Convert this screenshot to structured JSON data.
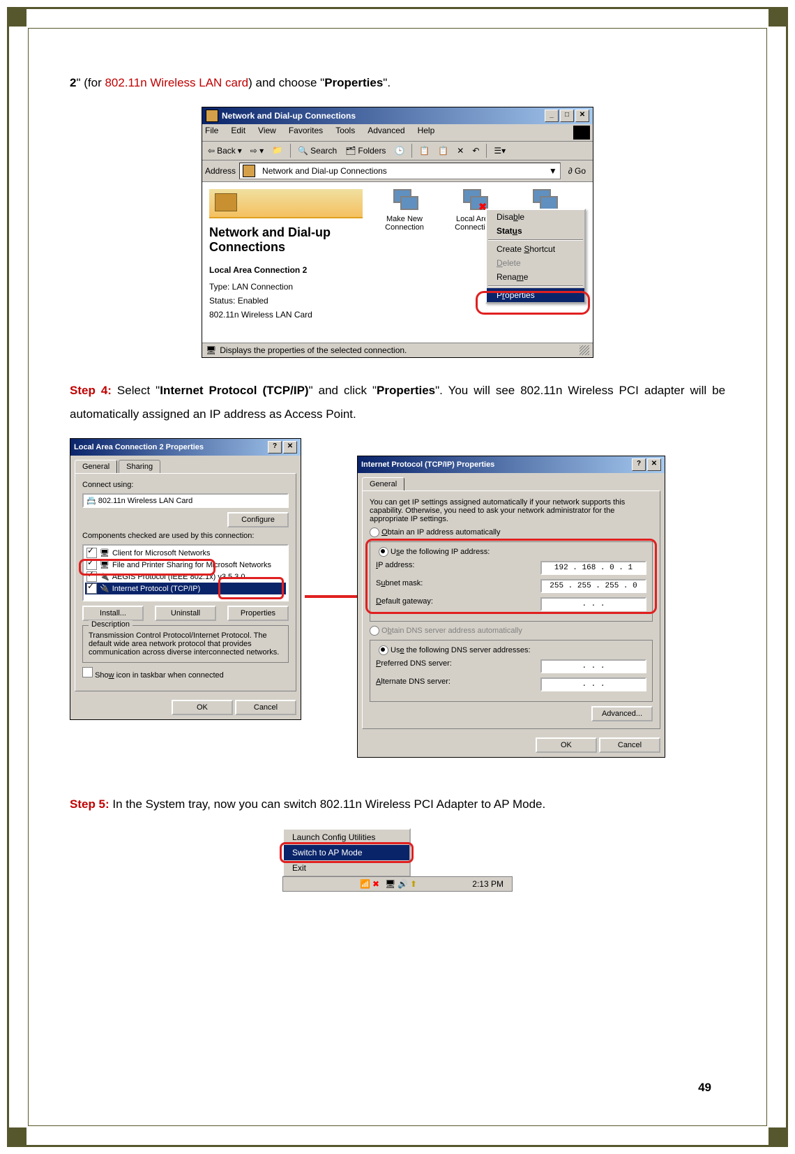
{
  "intro": {
    "prefix": "2",
    "mid1": "\" (for ",
    "link": "802.11n Wireless LAN card",
    "mid2": ") and choose \"",
    "bold": "Properties",
    "mid3": "\"."
  },
  "win1": {
    "title": "Network and Dial-up Connections",
    "menu": [
      "File",
      "Edit",
      "View",
      "Favorites",
      "Tools",
      "Advanced",
      "Help"
    ],
    "toolbar": {
      "back": "Back",
      "search": "Search",
      "folders": "Folders"
    },
    "addr_label": "Address",
    "addr_value": "Network and Dial-up Connections",
    "go": "Go",
    "panel_title": "Network and Dial-up Connections",
    "sel_title": "Local Area Connection 2",
    "type_line": "Type: LAN Connection",
    "status_line": "Status: Enabled",
    "card_line": "802.11n Wireless LAN Card",
    "items": {
      "makenew": "Make New Connection",
      "lac": "Local Area Connection",
      "lac2": "Local Area Connection 2"
    },
    "ctx": {
      "disable": "Disable",
      "status": "Status",
      "shortcut": "Create Shortcut",
      "delete": "Delete",
      "rename": "Rename",
      "properties": "Properties"
    },
    "statusbar": "Displays the properties of the selected connection."
  },
  "step4": {
    "label": "Step 4:",
    "t1": " Select \"",
    "b1": "Internet Protocol (TCP/IP)",
    "t2": "\" and click \"",
    "b2": "Properties",
    "t3": "\". You will see 802.11n Wireless PCI adapter will be automatically assigned an IP address as Access Point."
  },
  "dlg1": {
    "title": "Local Area Connection 2 Properties",
    "tab_general": "General",
    "tab_sharing": "Sharing",
    "connect_using": "Connect using:",
    "adapter": "802.11n Wireless LAN Card",
    "configure": "Configure",
    "components": "Components checked are used by this connection:",
    "list": [
      "Client for Microsoft Networks",
      "File and Printer Sharing for Microsoft Networks",
      "AEGIS Protocol (IEEE 802.1x) v3.5.3.0",
      "Internet Protocol (TCP/IP)"
    ],
    "install": "Install...",
    "uninstall": "Uninstall",
    "properties": "Properties",
    "desc_label": "Description",
    "desc_text": "Transmission Control Protocol/Internet Protocol. The default wide area network protocol that provides communication across diverse interconnected networks.",
    "show_icon": "Show icon in taskbar when connected",
    "ok": "OK",
    "cancel": "Cancel"
  },
  "dlg2": {
    "title": "Internet Protocol (TCP/IP) Properties",
    "tab_general": "General",
    "blurb": "You can get IP settings assigned automatically if your network supports this capability. Otherwise, you need to ask your network administrator for the appropriate IP settings.",
    "obtain_auto": "Obtain an IP address automatically",
    "use_ip": "Use the following IP address:",
    "ip_label": "IP address:",
    "ip_val": "192 . 168 .  0  .  1",
    "mask_label": "Subnet mask:",
    "mask_val": "255 . 255 . 255 .  0",
    "gw_label": "Default gateway:",
    "gw_val": ".       .       .",
    "obtain_dns": "Obtain DNS server address automatically",
    "use_dns": "Use the following DNS server addresses:",
    "pref_dns": "Preferred DNS server:",
    "pref_val": ".       .       .",
    "alt_dns": "Alternate DNS server:",
    "alt_val": ".       .       .",
    "advanced": "Advanced...",
    "ok": "OK",
    "cancel": "Cancel"
  },
  "step5": {
    "label": "Step 5:",
    "text": " In the System tray, now you can switch 802.11n Wireless PCI Adapter to AP Mode."
  },
  "tray": {
    "launch": "Launch Config Utilities",
    "switch": "Switch to AP Mode",
    "exit": "Exit",
    "time": "2:13 PM"
  },
  "page_num": "49"
}
